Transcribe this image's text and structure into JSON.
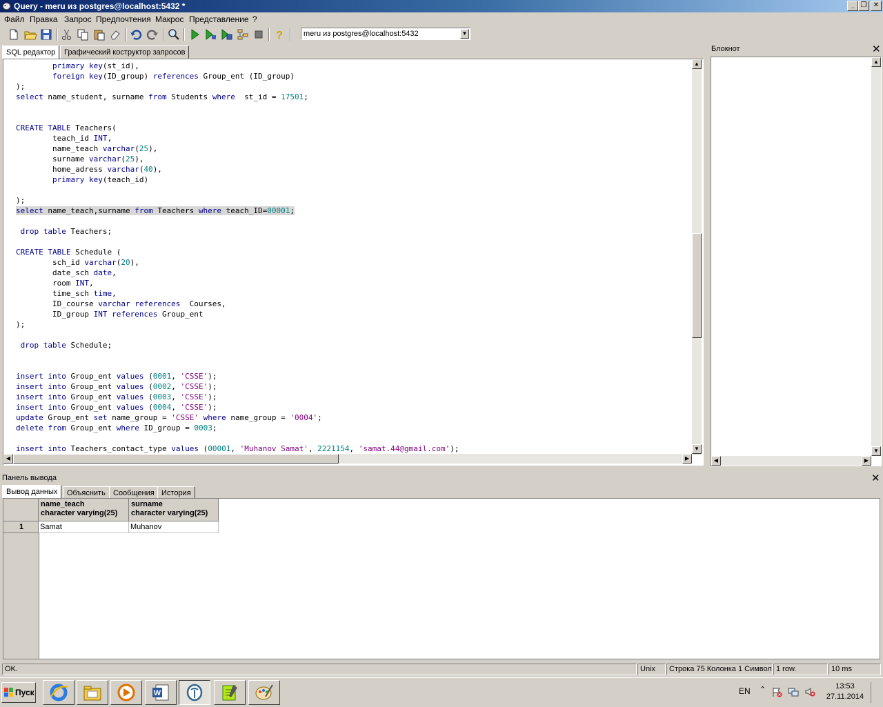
{
  "window": {
    "title": "Query - meru из postgres@localhost:5432 *"
  },
  "menu": [
    "Файл",
    "Правка",
    "Запрос",
    "Предпочтения",
    "Макрос",
    "Представление",
    "?"
  ],
  "toolbar": {
    "connection": "meru из postgres@localhost:5432"
  },
  "editor_tabs": [
    "SQL редактор",
    "Графический коструктор запросов"
  ],
  "code_lines": [
    "        primary key(st_id),",
    "        foreign key(ID_group) references Group_ent (ID_group)",
    ");",
    "select name_student, surname from Students where  st_id = 17501;",
    "",
    "",
    "CREATE TABLE Teachers(",
    "        teach_id INT,",
    "        name_teach varchar(25),",
    "        surname varchar(25),",
    "        home_adress varchar(40),",
    "        primary key(teach_id)",
    "",
    ");",
    "select name_teach,surname from Teachers where teach_ID=00001;",
    "",
    " drop table Teachers;",
    "",
    "CREATE TABLE Schedule (",
    "        sch_id varchar(20),",
    "        date_sch date,",
    "        room INT,",
    "        time_sch time,",
    "        ID_course varchar references  Courses,",
    "        ID_group INT references Group_ent",
    ");",
    "",
    " drop table Schedule;",
    "",
    "",
    "insert into Group_ent values (0001, 'CSSE');",
    "insert into Group_ent values (0002, 'CSSE');",
    "insert into Group_ent values (0003, 'CSSE');",
    "insert into Group_ent values (0004, 'CSSE');",
    "update Group_ent set name_group = 'CSSE' where name_group = '0004';",
    "delete from Group_ent where ID_group = 0003;",
    "",
    "insert into Teachers_contact_type values (00001, 'Muhanov Samat', 2221154, 'samat.44@gmail.com');"
  ],
  "highlighted_line": 14,
  "notepad": {
    "title": "Блокнот"
  },
  "output_panel": {
    "title": "Панель вывода",
    "tabs": [
      "Вывод данных",
      "Объяснить",
      "Сообщения",
      "История"
    ],
    "columns": [
      {
        "name": "name_teach",
        "type": "character varying(25)"
      },
      {
        "name": "surname",
        "type": "character varying(25)"
      }
    ],
    "rows": [
      {
        "num": "1",
        "cells": [
          "Samat",
          "Muhanov"
        ]
      }
    ]
  },
  "statusbar": {
    "message": "OK.",
    "eol": "Unix",
    "position": "Строка 75 Колонка 1 Символ",
    "rows": "1 row.",
    "time": "10 ms"
  },
  "taskbar": {
    "start_label": "Пуск",
    "apps": [
      "internet-explorer-icon",
      "file-manager-icon",
      "media-player-icon",
      "word-icon",
      "pgadmin-icon",
      "notepad-plus-icon",
      "paint-icon"
    ],
    "lang": "EN",
    "time": "13:53",
    "date": "27.11.2014"
  }
}
